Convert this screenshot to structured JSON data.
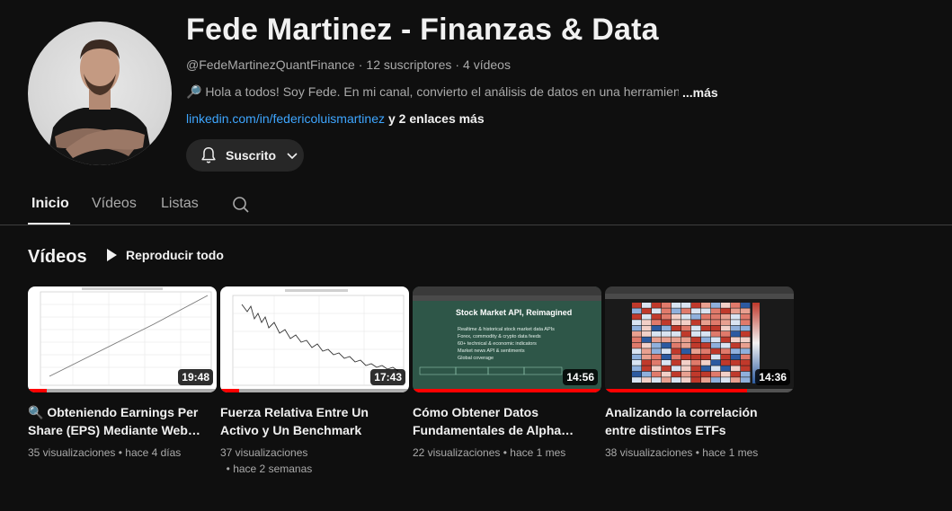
{
  "channel": {
    "name": "Fede Martinez - Finanzas & Data",
    "handle": "@FedeMartinezQuantFinance",
    "subscribers": "12 suscriptores",
    "videos_count": "4 vídeos",
    "description": "🔎 Hola a todos! Soy Fede. En mi canal, convierto el análisis de datos en una herramienta",
    "more_label": "...más",
    "link": "linkedin.com/in/federicoluismartinez",
    "more_links": "y 2 enlaces más",
    "subscribe_label": "Suscrito"
  },
  "tabs": [
    {
      "label": "Inicio",
      "active": true
    },
    {
      "label": "Vídeos",
      "active": false
    },
    {
      "label": "Listas",
      "active": false
    }
  ],
  "section": {
    "title": "Vídeos",
    "play_all": "Reproducir todo"
  },
  "videos": [
    {
      "title": "🔍 Obteniendo Earnings Per Share (EPS) Mediante Web…",
      "duration": "19:48",
      "views": "35 visualizaciones",
      "age": "hace 4 días",
      "watched_fraction": 0.1
    },
    {
      "title": "Fuerza Relativa Entre Un Activo y Un Benchmark",
      "duration": "17:43",
      "views": "37 visualizaciones",
      "age": "hace 2 semanas",
      "watched_fraction": 0.1
    },
    {
      "title": "Cómo Obtener Datos Fundamentales de Alpha…",
      "duration": "14:56",
      "views": "22 visualizaciones",
      "age": "hace 1 mes",
      "watched_fraction": 1.0
    },
    {
      "title": "Analizando la correlación entre distintos ETFs",
      "duration": "14:36",
      "views": "38 visualizaciones",
      "age": "hace 1 mes",
      "watched_fraction": 0.75
    }
  ],
  "thumb3": {
    "heading": "Stock Market API, Reimagined",
    "bullets": [
      "Realtime & historical stock market data APIs",
      "Forex, commodity & crypto data feeds",
      "60+ technical & economic indicators",
      "Market news API & sentiments",
      "Global coverage"
    ]
  },
  "colors": {
    "accent_red": "#ff0000",
    "link_blue": "#3ea6ff",
    "background": "#0f0f0f"
  }
}
